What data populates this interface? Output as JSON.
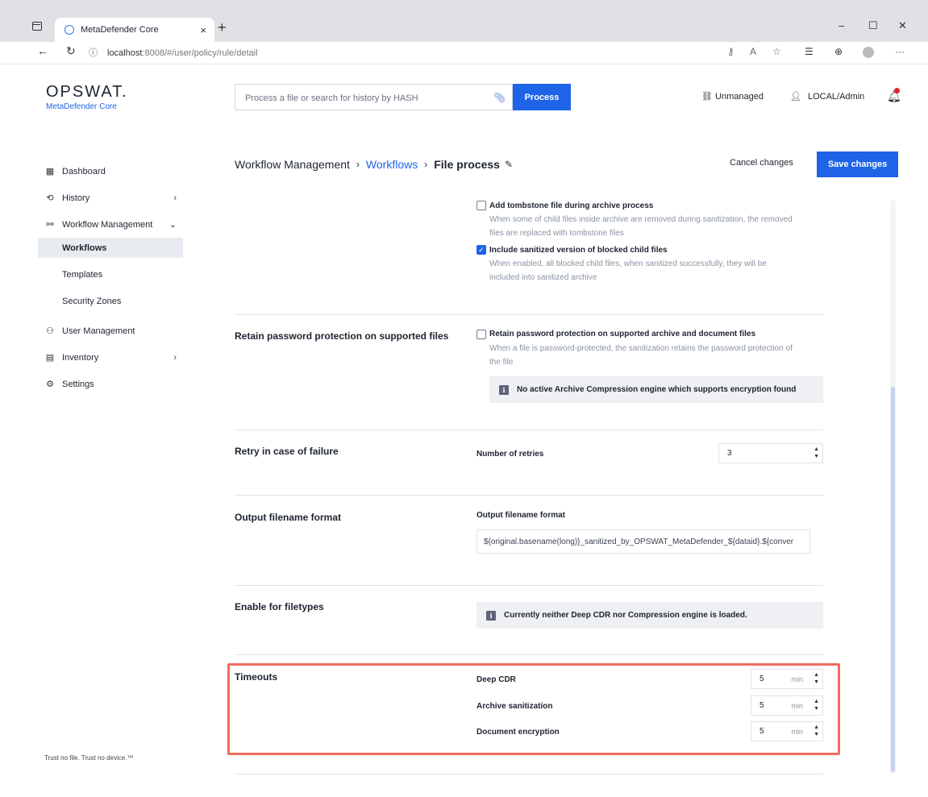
{
  "browser": {
    "tab_title": "MetaDefender Core",
    "tab_close": "×",
    "new_tab": "+",
    "url_host": "localhost",
    "url_rest": ":8008/#/user/policy/rule/detail",
    "win_minimize": "–",
    "win_maximize": "☐",
    "win_close": "✕",
    "nav_back": "←",
    "nav_reload": "↻",
    "info": "ⓘ",
    "toolbar_icons": [
      "key-icon",
      "read-aloud-icon",
      "favorite-icon",
      "favorites-icon",
      "collections-icon",
      "profile-icon",
      "more-icon"
    ]
  },
  "brand": {
    "logo": "OPSWAT.",
    "product": "MetaDefender Core"
  },
  "header": {
    "search_placeholder": "Process a file or search for history by HASH",
    "process_label": "Process",
    "unmanaged_label": "Unmanaged",
    "user_label": "LOCAL/Admin"
  },
  "sidebar": {
    "items": [
      {
        "label": "Dashboard",
        "icon": "dashboard-icon"
      },
      {
        "label": "History",
        "icon": "history-icon"
      },
      {
        "label": "Workflow Management",
        "icon": "workflow-icon"
      },
      {
        "label": "User Management",
        "icon": "users-icon"
      },
      {
        "label": "Inventory",
        "icon": "inventory-icon"
      },
      {
        "label": "Settings",
        "icon": "gear-icon"
      }
    ],
    "sub_items": [
      "Workflows",
      "Templates",
      "Security Zones"
    ],
    "tagline": "Trust no file. Trust no device.™"
  },
  "breadcrumb": {
    "root": "Workflow Management",
    "link": "Workflows",
    "current": "File process"
  },
  "actions": {
    "cancel_label": "Cancel changes",
    "save_label": "Save changes"
  },
  "archive_options": {
    "tombstone_label": "Add tombstone file during archive process",
    "tombstone_desc1": "When some of child files inside archive are removed during sanitization, the removed",
    "tombstone_desc2": "files are replaced with tombstone files",
    "tombstone_checked": false,
    "include_label": "Include sanitized version of blocked child files",
    "include_desc1": "When enabled, all blocked child files, when sanitized successfully, they will be",
    "include_desc2": "included into sanitized archive",
    "include_checked": true
  },
  "retain_password": {
    "section": "Retain password protection on supported files",
    "label": "Retain password protection on supported archive and document files",
    "desc1": "When a file is password-protected, the sanitization retains the password protection of",
    "desc2": "the file",
    "checked": false,
    "notice": "No active Archive Compression engine which supports encryption found"
  },
  "retry": {
    "section": "Retry in case of failure",
    "label": "Number of retries",
    "value": "3"
  },
  "output_format": {
    "section": "Output filename format",
    "label": "Output filename format",
    "value": "${original.basename(long)}_sanitized_by_OPSWAT_MetaDefender_${dataid}.${conver"
  },
  "filetypes": {
    "section": "Enable for filetypes",
    "notice": "Currently neither Deep CDR nor Compression engine is loaded."
  },
  "timeouts": {
    "section": "Timeouts",
    "unit": "min",
    "rows": [
      {
        "label": "Deep CDR",
        "value": "5"
      },
      {
        "label": "Archive sanitization",
        "value": "5"
      },
      {
        "label": "Document encryption",
        "value": "5"
      }
    ]
  }
}
